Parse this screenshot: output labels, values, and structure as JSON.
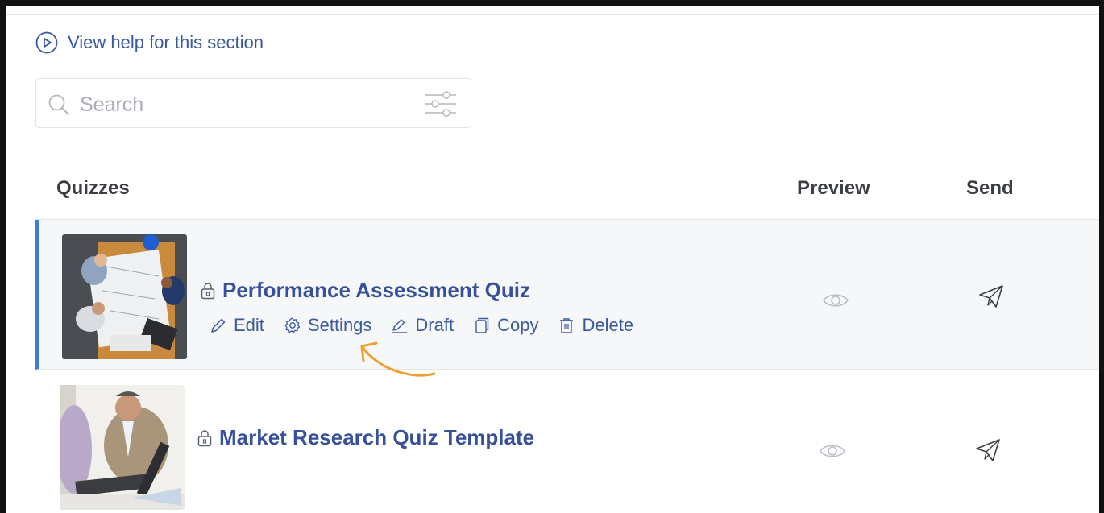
{
  "help": {
    "label": "View help for this section"
  },
  "search": {
    "placeholder": "Search"
  },
  "columns": {
    "quizzes": "Quizzes",
    "preview": "Preview",
    "send": "Send"
  },
  "quizzes": [
    {
      "title": "Performance Assessment Quiz",
      "actions": {
        "edit": "Edit",
        "settings": "Settings",
        "draft": "Draft",
        "copy": "Copy",
        "delete": "Delete"
      }
    },
    {
      "title": "Market Research Quiz Template"
    }
  ],
  "icons": {
    "help": "play-circle-icon",
    "search": "search-icon",
    "filter": "sliders-icon",
    "lock": "lock-icon",
    "preview": "eye-icon",
    "send": "paper-plane-icon",
    "edit": "pencil-icon",
    "settings": "gear-icon",
    "draft": "draft-pen-icon",
    "copy": "copy-icon",
    "delete": "trash-icon"
  },
  "colors": {
    "accent": "#3b7fd6",
    "link": "#36509a",
    "annotation": "#f0a030"
  }
}
